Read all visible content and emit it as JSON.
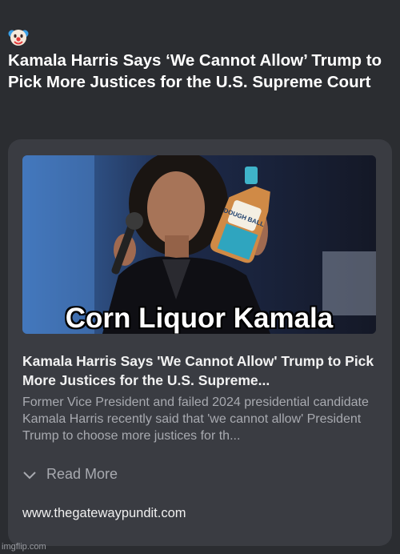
{
  "post": {
    "emoji_icon": "clown-face-icon",
    "title": "Kamala Harris Says ‘We Cannot Allow’ Trump to Pick More Justices for the U.S. Supreme Court"
  },
  "card": {
    "image": {
      "caption": "Corn Liquor Kamala",
      "bottle_label": "DOUGH BALL"
    },
    "article_title": "Kamala Harris Says 'We Cannot Allow' Trump to Pick More Justices for the U.S. Supreme...",
    "description": "Former Vice President and failed 2024 presidential candidate Kamala Harris recently said that 'we cannot allow' President Trump to choose more justices for th...",
    "read_more_label": "Read More",
    "read_more_icon": "chevron-down-icon",
    "source_url": "www.thegatewaypundit.com"
  },
  "watermark": "imgflip.com",
  "colors": {
    "background": "#2b2d31",
    "card": "#3a3c42",
    "muted_text": "#a8aab0"
  }
}
